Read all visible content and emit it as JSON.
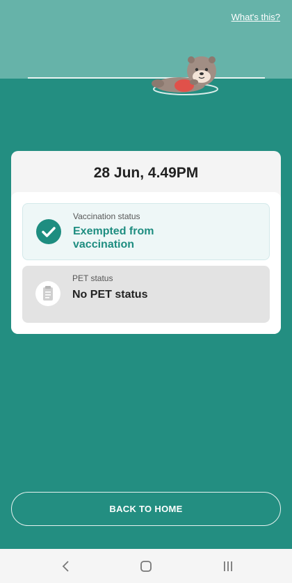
{
  "header": {
    "whats_this": "What's this?"
  },
  "card": {
    "date_time": "28 Jun, 4.49PM",
    "vaccination": {
      "label": "Vaccination status",
      "value": "Exempted from vaccination"
    },
    "pet": {
      "label": "PET status",
      "value": "No PET status"
    }
  },
  "actions": {
    "back_home": "BACK TO HOME"
  },
  "navbar": {
    "icons": [
      "back-icon",
      "home-icon",
      "recents-icon"
    ]
  },
  "colors": {
    "background": "#238e81",
    "top_band": "#66b3a9",
    "accent": "#1e8d80"
  }
}
